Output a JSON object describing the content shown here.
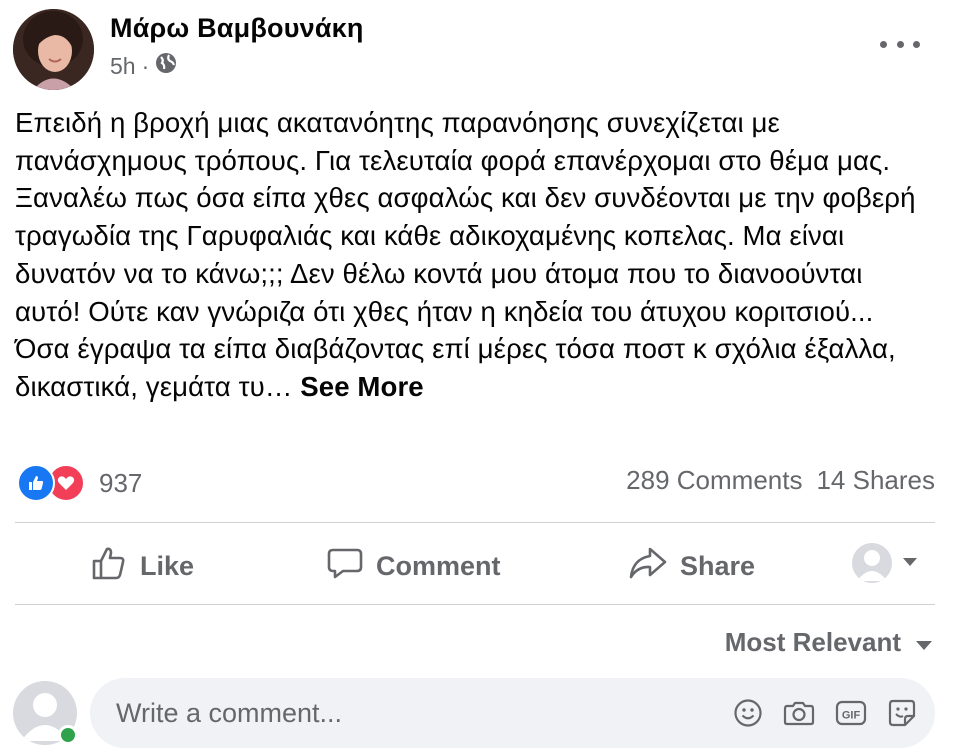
{
  "post": {
    "author": "Μάρω Βαμβουνάκη",
    "time": "5h",
    "separator": "·",
    "visibility_icon": "globe-icon",
    "text": "Επειδή η βροχή μιας ακατανόητης παρανόησης συνεχίζεται με πανάσχημους τρόπους. Για τελευταία φορά επανέρχομαι στο θέμα μας. Ξαναλέω πως όσα είπα χθες ασφαλώς και δεν συνδέονται με την φοβερή τραγωδία της Γαρυφαλιάς και κάθε αδικοχαμένης κοπελας. Μα είναι δυνατόν να το κάνω;;; Δεν θέλω κοντά μου άτομα που το διανοούνται αυτό! Ούτε καν γνώριζα ότι χθες ήταν η κηδεία του άτυχου κοριτσιού...\nΌσα έγραψα τα είπα διαβάζοντας  επί μέρες τόσα ποστ κ σχόλια έξαλλα, δικαστικά, γεμάτα τυ…",
    "see_more": "See More"
  },
  "stats": {
    "reaction_count": "937",
    "reaction_icons": [
      "like-icon",
      "love-icon"
    ],
    "comments": "289 Comments",
    "shares": "14 Shares"
  },
  "actions": {
    "like": "Like",
    "comment": "Comment",
    "share": "Share"
  },
  "sort": {
    "label": "Most Relevant"
  },
  "composer": {
    "placeholder": "Write a comment...",
    "icons": [
      "emoji-icon",
      "camera-icon",
      "gif-icon",
      "sticker-icon"
    ]
  },
  "colors": {
    "like_blue": "#1877f2",
    "love_red": "#f33e58",
    "secondary_text": "#65676b",
    "input_bg": "#f0f2f5",
    "online_green": "#31a24c"
  }
}
